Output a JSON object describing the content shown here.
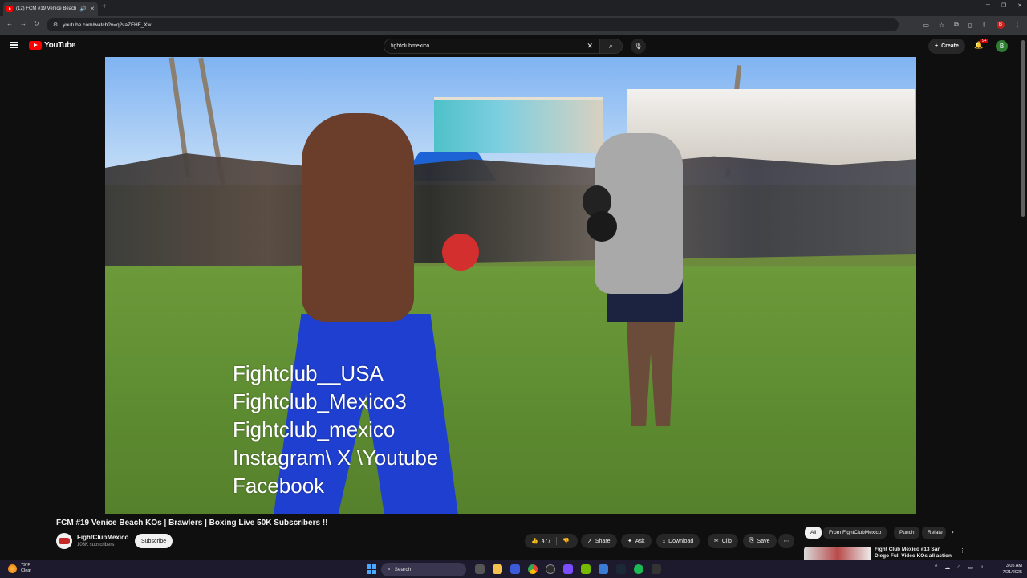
{
  "browser": {
    "tab_title": "(12) FCM #19 Venice Beach",
    "url": "youtube.com/watch?v=q2vaZFHF_Xw",
    "profile_initial": "B"
  },
  "youtube": {
    "logo_text": "YouTube",
    "search_query": "fightclubmexico",
    "create_label": "Create",
    "notifications_badge": "9+",
    "avatar_initial": "B"
  },
  "video": {
    "overlay_lines": [
      "Fightclub__USA",
      "Fightclub_Mexico3",
      "Fightclub_mexico",
      "Instagram\\ X \\Youtube",
      "Facebook"
    ],
    "title": "FCM #19 Venice Beach KOs | Brawlers | Boxing Live 50K Subscribers !!",
    "channel_name": "FightClubMexico",
    "subscribers": "103K subscribers",
    "subscribe_label": "Subscribe",
    "like_count": "477",
    "actions": {
      "share": "Share",
      "ask": "Ask",
      "download": "Download",
      "clip": "Clip",
      "save": "Save"
    }
  },
  "sidebar": {
    "chips": [
      "All",
      "From FightClubMexico",
      "Punch",
      "Relate"
    ],
    "recommendation_title": "Fight Club Mexico #13 San Diego Full Video KOs all action"
  },
  "taskbar": {
    "weather_temp": "79°F",
    "weather_desc": "Clear",
    "search_label": "Search",
    "time": "3:05 AM",
    "date": "7/21/2025"
  },
  "colors": {
    "youtube_red": "#ff0000",
    "background": "#0f0f0f",
    "pill": "#272727"
  }
}
